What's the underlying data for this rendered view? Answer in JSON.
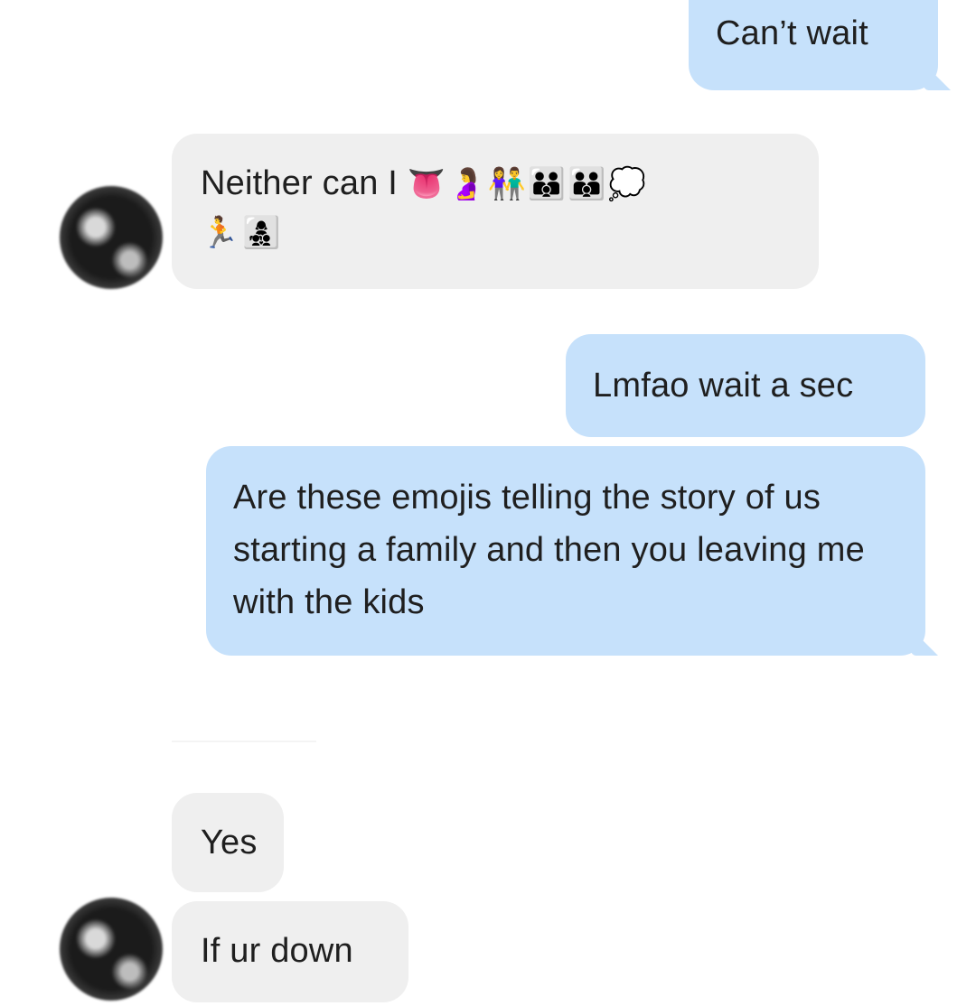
{
  "conversation": {
    "messages": [
      {
        "id": "m1",
        "sender": "me",
        "text": "Can’t wait"
      },
      {
        "id": "m2",
        "sender": "them",
        "text": "Neither can I",
        "emojis_line1": "👅🤰👫👪👪💭",
        "emojis_line2": "🏃👩‍👧‍👦"
      },
      {
        "id": "m3",
        "sender": "me",
        "text": "Lmfao wait a sec"
      },
      {
        "id": "m4",
        "sender": "me",
        "text": "Are these emojis telling the story of us starting a family and then you leaving me with the kids"
      },
      {
        "id": "m5",
        "sender": "them",
        "text": "Yes"
      },
      {
        "id": "m6",
        "sender": "them",
        "text": "If ur down"
      }
    ]
  },
  "colors": {
    "sent_bubble": "#c6e1fb",
    "received_bubble": "#efefef",
    "background": "#ffffff"
  },
  "icons": {
    "contact_avatar": "avatar"
  }
}
